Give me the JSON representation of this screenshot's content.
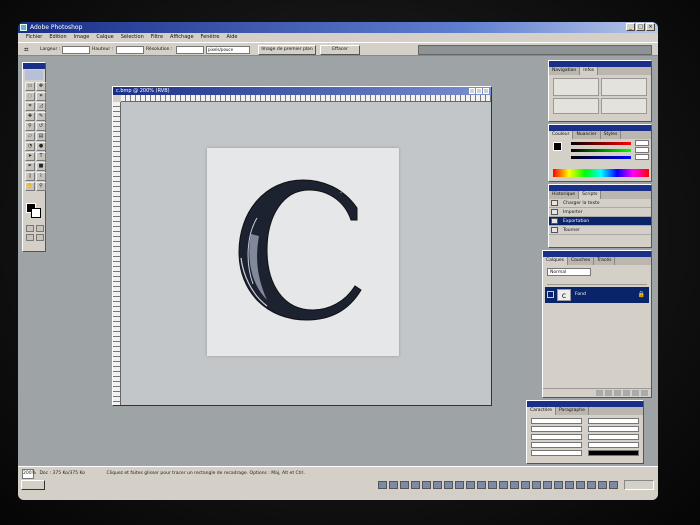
{
  "window": {
    "title": "Adobe Photoshop"
  },
  "menu": [
    "Fichier",
    "Edition",
    "Image",
    "Calque",
    "Sélection",
    "Filtre",
    "Affichage",
    "Fenêtre",
    "Aide"
  ],
  "options_bar": {
    "largeur_label": "Largeur :",
    "hauteur_label": "Hauteur :",
    "resolution_label": "Résolution :",
    "unit_value": "pixels/pouce",
    "front_image_button": "Image de premier plan",
    "clear_button": "Effacer"
  },
  "document": {
    "title": "c.bmp @ 200% (RVB)",
    "letter": "C"
  },
  "panels": {
    "navigator": {
      "tabs": [
        "Navigation",
        "Infos"
      ]
    },
    "color": {
      "tabs": [
        "Couleur",
        "Nuancier",
        "Styles"
      ]
    },
    "history": {
      "tabs": [
        "Historique",
        "Scripts"
      ],
      "items": [
        "Charger la texte",
        "Importer",
        "Exportation",
        "Tourner"
      ]
    },
    "layers": {
      "tabs": [
        "Calques",
        "Couches",
        "Tracés"
      ],
      "blend_mode": "Normal",
      "layer_name": "Fond"
    },
    "character": {
      "tabs": [
        "Caractère",
        "Paragraphe"
      ]
    }
  },
  "status_bar": {
    "zoom": "200%",
    "doc_info": "Doc : 375 Ko/375 Ko",
    "hint": "Cliquez et faites glisser pour tracer un rectangle de recadrage. Options : Maj, Alt et Ctrl."
  },
  "colors": {
    "accent": "#1a2f88",
    "chrome": "#d4d0c8",
    "workspace": "#9ea3a5"
  }
}
